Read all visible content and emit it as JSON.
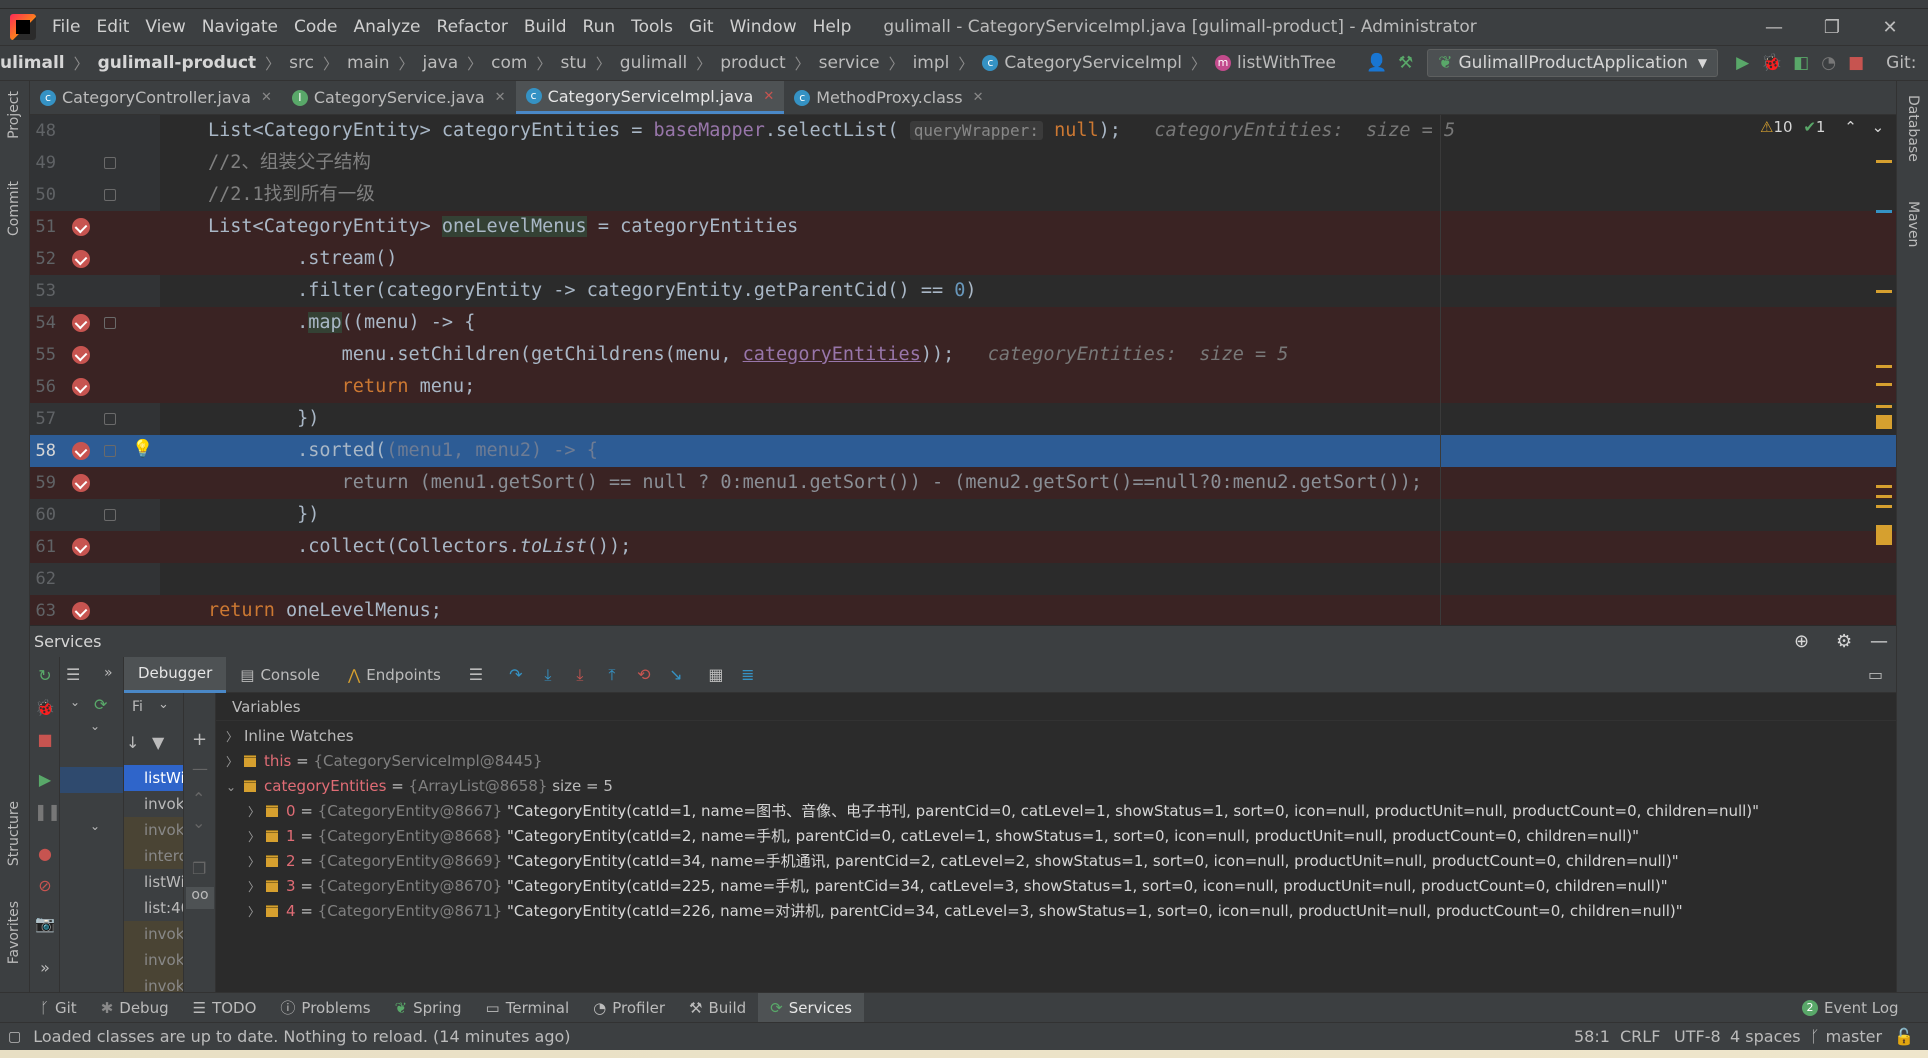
{
  "menubar": {
    "items": [
      "File",
      "Edit",
      "View",
      "Navigate",
      "Code",
      "Analyze",
      "Refactor",
      "Build",
      "Run",
      "Tools",
      "Git",
      "Window",
      "Help"
    ],
    "window_title": "gulimall - CategoryServiceImpl.java [gulimall-product] - Administrator"
  },
  "navbar": {
    "crumbs": [
      "ulimall",
      "gulimall-product",
      "src",
      "main",
      "java",
      "com",
      "stu",
      "gulimall",
      "product",
      "service",
      "impl"
    ],
    "class_crumb": "CategoryServiceImpl",
    "method_crumb": "listWithTree",
    "run_config": "GulimallProductApplication",
    "git_label": "Git:"
  },
  "tabs": [
    {
      "label": "CategoryController.java",
      "icon": "class-icon",
      "active": false
    },
    {
      "label": "CategoryService.java",
      "icon": "interface-icon",
      "active": false
    },
    {
      "label": "CategoryServiceImpl.java",
      "icon": "class-icon",
      "active": true
    },
    {
      "label": "MethodProxy.class",
      "icon": "class-icon",
      "active": false
    }
  ],
  "editor": {
    "inspections": {
      "warnings": "10",
      "checks": "1"
    },
    "line_numbers": [
      "48",
      "49",
      "50",
      "51",
      "52",
      "53",
      "54",
      "55",
      "56",
      "57",
      "58",
      "59",
      "60",
      "61",
      "62",
      "63"
    ],
    "line48": {
      "a": "List<CategoryEntity> categoryEntities = ",
      "b": "baseMapper",
      "c": ".selectList( ",
      "param": "queryWrapper:",
      "d": " null",
      "e": ");",
      "hint": "categoryEntities:  size = 5"
    },
    "line49": "//2、组装父子结构",
    "line50": "//2.1找到所有一级",
    "line51": {
      "a": "List<CategoryEntity> ",
      "b": "oneLevelMenus",
      "c": " = categoryEntities"
    },
    "line52": "        .stream()",
    "line53": {
      "a": "        .filter(categoryEntity -> categoryEntity.getParentCid() == ",
      "b": "0",
      "c": ")"
    },
    "line54": {
      "a": "        .",
      "b": "map",
      "c": "((menu) -> {"
    },
    "line55": {
      "a": "            menu.setChildren(getChildrens(menu, ",
      "b": "categoryEntities",
      "c": "));",
      "hint": "categoryEntities:  size = 5"
    },
    "line56": {
      "kw": "return",
      "rest": " menu;"
    },
    "line57": "        })",
    "line58": {
      "a": "        .sorted(",
      "b": "(menu1, menu2) -> {"
    },
    "line59": "            return (menu1.getSort() == null ? 0:menu1.getSort()) - (menu2.getSort()==null?0:menu2.getSort());",
    "line60": "        })",
    "line61": {
      "a": "        .collect(Collectors.",
      "b": "toList",
      "c": "());"
    },
    "line62": "",
    "line63": {
      "kw": "return",
      "rest": " oneLevelMenus;"
    }
  },
  "services": {
    "title": "Services",
    "debug_tabs": [
      "Debugger",
      "Console",
      "Endpoints"
    ],
    "frames_filter": "Fi",
    "frames": [
      "listWi",
      "invok",
      "invok",
      "interc",
      "listWi",
      "list:40",
      "invok",
      "invok",
      "invok"
    ],
    "variables_header": "Variables",
    "inline_watches": "Inline Watches",
    "this_var": {
      "name": "this",
      "ref": "{CategoryServiceImpl@8445}"
    },
    "list_var": {
      "name": "categoryEntities",
      "ref": "{ArrayList@8658}",
      "size": "size = 5"
    },
    "entries": [
      {
        "idx": "0",
        "ref": "{CategoryEntity@8667}",
        "val": "\"CategoryEntity(catId=1, name=图书、音像、电子书刊, parentCid=0, catLevel=1, showStatus=1, sort=0, icon=null, productUnit=null, productCount=0, children=null)\""
      },
      {
        "idx": "1",
        "ref": "{CategoryEntity@8668}",
        "val": "\"CategoryEntity(catId=2, name=手机, parentCid=0, catLevel=1, showStatus=1, sort=0, icon=null, productUnit=null, productCount=0, children=null)\""
      },
      {
        "idx": "2",
        "ref": "{CategoryEntity@8669}",
        "val": "\"CategoryEntity(catId=34, name=手机通讯, parentCid=2, catLevel=2, showStatus=1, sort=0, icon=null, productUnit=null, productCount=0, children=null)\""
      },
      {
        "idx": "3",
        "ref": "{CategoryEntity@8670}",
        "val": "\"CategoryEntity(catId=225, name=手机, parentCid=34, catLevel=3, showStatus=1, sort=0, icon=null, productUnit=null, productCount=0, children=null)\""
      },
      {
        "idx": "4",
        "ref": "{CategoryEntity@8671}",
        "val": "\"CategoryEntity(catId=226, name=对讲机, parentCid=34, catLevel=3, showStatus=1, sort=0, icon=null, productUnit=null, productCount=0, children=null)\""
      }
    ]
  },
  "bottom_tabs": [
    "Git",
    "Debug",
    "TODO",
    "Problems",
    "Spring",
    "Terminal",
    "Profiler",
    "Build",
    "Services"
  ],
  "event_log": {
    "count": "2",
    "label": "Event Log"
  },
  "statusbar": {
    "message": "Loaded classes are up to date. Nothing to reload. (14 minutes ago)",
    "position": "58:1",
    "line_sep": "CRLF",
    "encoding": "UTF-8",
    "indent": "4 spaces",
    "branch": "master"
  },
  "side_labels": {
    "project": "Project",
    "commit": "Commit",
    "structure": "Structure",
    "favorites": "Favorites",
    "database": "Database",
    "maven": "Maven"
  },
  "colors": {
    "accent": "#4a88c7",
    "breakpoint": "#c75450",
    "current_line": "#2d5c95",
    "warning": "#d6a02f"
  }
}
